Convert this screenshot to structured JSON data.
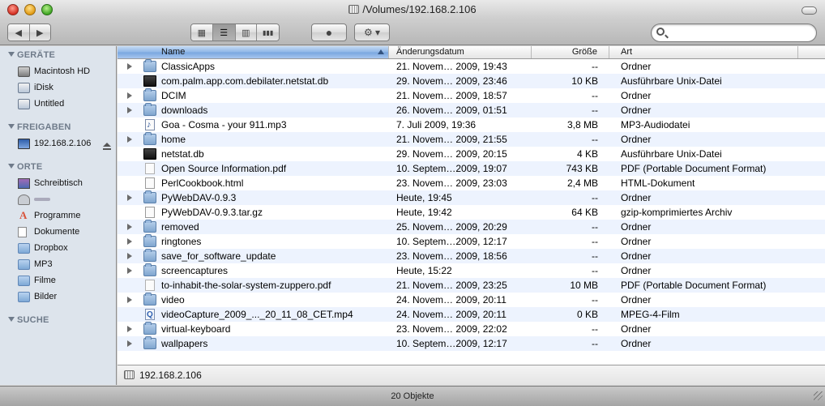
{
  "window": {
    "title": "/Volumes/192.168.2.106"
  },
  "toolbar": {
    "back_label": "◀",
    "forward_label": "▶",
    "view_icon_label": "▦",
    "view_list_label": "☰",
    "view_column_label": "▥",
    "view_coverflow_label": "▮▮▮",
    "quicklook_label": "●",
    "action_label": "⚙ ▾",
    "search_placeholder": ""
  },
  "sidebar": {
    "sections": [
      {
        "title": "GERÄTE",
        "items": [
          {
            "label": "Macintosh HD",
            "icon": "hard-drive-icon"
          },
          {
            "label": "iDisk",
            "icon": "idisk-icon"
          },
          {
            "label": "Untitled",
            "icon": "disk-icon"
          }
        ]
      },
      {
        "title": "FREIGABEN",
        "items": [
          {
            "label": "192.168.2.106",
            "icon": "network-monitor-icon"
          }
        ]
      },
      {
        "title": "ORTE",
        "items": [
          {
            "label": "Schreibtisch",
            "icon": "desktop-icon"
          },
          {
            "label": "",
            "icon": "home-icon"
          },
          {
            "label": "Programme",
            "icon": "applications-icon"
          },
          {
            "label": "Dokumente",
            "icon": "documents-icon"
          },
          {
            "label": "Dropbox",
            "icon": "folder-icon"
          },
          {
            "label": "MP3",
            "icon": "folder-icon"
          },
          {
            "label": "Filme",
            "icon": "folder-icon"
          },
          {
            "label": "Bilder",
            "icon": "folder-icon"
          }
        ]
      },
      {
        "title": "SUCHE",
        "items": []
      }
    ]
  },
  "list": {
    "columns": {
      "name": "Name",
      "date": "Änderungsdatum",
      "size": "Größe",
      "kind": "Art"
    },
    "rows": [
      {
        "name": "ClassicApps",
        "date": "21. Novem… 2009, 19:43",
        "size": "--",
        "kind": "Ordner",
        "type": "folder"
      },
      {
        "name": "com.palm.app.com.debilater.netstat.db",
        "date": "29. Novem… 2009, 23:46",
        "size": "10 KB",
        "kind": "Ausführbare Unix-Datei",
        "type": "exec"
      },
      {
        "name": "DCIM",
        "date": "21. Novem… 2009, 18:57",
        "size": "--",
        "kind": "Ordner",
        "type": "folder"
      },
      {
        "name": "downloads",
        "date": "26. Novem… 2009, 01:51",
        "size": "--",
        "kind": "Ordner",
        "type": "folder"
      },
      {
        "name": "Goa - Cosma - your 911.mp3",
        "date": "7. Juli 2009, 19:36",
        "size": "3,8 MB",
        "kind": "MP3-Audiodatei",
        "type": "mp3"
      },
      {
        "name": "home",
        "date": "21. Novem… 2009, 21:55",
        "size": "--",
        "kind": "Ordner",
        "type": "folder"
      },
      {
        "name": "netstat.db",
        "date": "29. Novem… 2009, 20:15",
        "size": "4 KB",
        "kind": "Ausführbare Unix-Datei",
        "type": "exec"
      },
      {
        "name": "Open Source Information.pdf",
        "date": "10. Septem…2009, 19:07",
        "size": "743 KB",
        "kind": "PDF (Portable Document Format)",
        "type": "pdf"
      },
      {
        "name": "PerlCookbook.html",
        "date": "23. Novem… 2009, 23:03",
        "size": "2,4 MB",
        "kind": "HTML-Dokument",
        "type": "file"
      },
      {
        "name": "PyWebDAV-0.9.3",
        "date": "Heute, 19:45",
        "size": "--",
        "kind": "Ordner",
        "type": "folder"
      },
      {
        "name": "PyWebDAV-0.9.3.tar.gz",
        "date": "Heute, 19:42",
        "size": "64 KB",
        "kind": "gzip-komprimiertes Archiv",
        "type": "file"
      },
      {
        "name": "removed",
        "date": "25. Novem… 2009, 20:29",
        "size": "--",
        "kind": "Ordner",
        "type": "folder"
      },
      {
        "name": "ringtones",
        "date": "10. Septem…2009, 12:17",
        "size": "--",
        "kind": "Ordner",
        "type": "folder"
      },
      {
        "name": "save_for_software_update",
        "date": "23. Novem… 2009, 18:56",
        "size": "--",
        "kind": "Ordner",
        "type": "folder"
      },
      {
        "name": "screencaptures",
        "date": "Heute, 15:22",
        "size": "--",
        "kind": "Ordner",
        "type": "folder"
      },
      {
        "name": "to-inhabit-the-solar-system-zuppero.pdf",
        "date": "21. Novem… 2009, 23:25",
        "size": "10 MB",
        "kind": "PDF (Portable Document Format)",
        "type": "pdf"
      },
      {
        "name": "video",
        "date": "24. Novem… 2009, 20:11",
        "size": "--",
        "kind": "Ordner",
        "type": "folder"
      },
      {
        "name": "videoCapture_2009_..._20_11_08_CET.mp4",
        "date": "24. Novem… 2009, 20:11",
        "size": "0 KB",
        "kind": "MPEG-4-Film",
        "type": "mp4"
      },
      {
        "name": "virtual-keyboard",
        "date": "23. Novem… 2009, 22:02",
        "size": "--",
        "kind": "Ordner",
        "type": "folder"
      },
      {
        "name": "wallpapers",
        "date": "10. Septem…2009, 12:17",
        "size": "--",
        "kind": "Ordner",
        "type": "folder"
      }
    ]
  },
  "pathbar": {
    "label": "192.168.2.106"
  },
  "status": {
    "text": "20 Objekte"
  }
}
